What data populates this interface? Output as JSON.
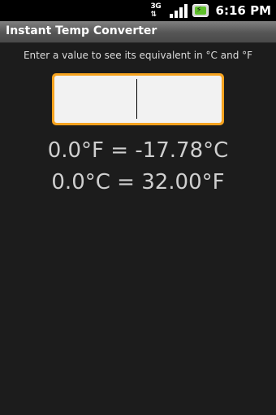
{
  "status_bar": {
    "network_label": "3G",
    "network_arrows": "⇅",
    "time": "6:16 PM",
    "icons": [
      "3g-data-icon",
      "signal-icon",
      "battery-charging-icon"
    ],
    "battery_color": "#5fbf2b"
  },
  "app": {
    "title": "Instant Temp Converter"
  },
  "main": {
    "instructions": "Enter a value to see its equivalent in °C and °F",
    "input": {
      "value": "",
      "placeholder": ""
    },
    "result_f_to_c": "0.0°F = -17.78°C",
    "result_c_to_f": "0.0°C = 32.00°F",
    "accent_color": "#f6a31f"
  }
}
